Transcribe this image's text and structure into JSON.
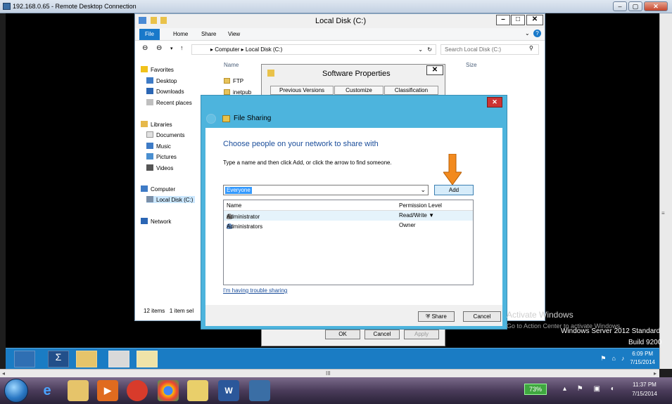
{
  "rdp": {
    "title": "192.168.0.65 - Remote Desktop Connection",
    "min": "–",
    "max": "▢",
    "close": "✕",
    "hscroll_mark": "III"
  },
  "explorer": {
    "title": "Local Disk (C:)",
    "ribbon_tabs": [
      "File",
      "Home",
      "Share",
      "View"
    ],
    "address": [
      "Computer",
      "Local Disk (C:)"
    ],
    "search_placeholder": "Search Local Disk (C:)",
    "nav": [
      {
        "label": "Favorites",
        "icon": "star-icon"
      },
      {
        "label": "Desktop",
        "icon": "desktop-icon"
      },
      {
        "label": "Downloads",
        "icon": "downloads-icon"
      },
      {
        "label": "Recent places",
        "icon": "recent-places-icon"
      },
      {
        "label": "Libraries",
        "icon": "libraries-icon"
      },
      {
        "label": "Documents",
        "icon": "documents-icon"
      },
      {
        "label": "Music",
        "icon": "music-icon"
      },
      {
        "label": "Pictures",
        "icon": "pictures-icon"
      },
      {
        "label": "Videos",
        "icon": "videos-icon"
      },
      {
        "label": "Computer",
        "icon": "computer-icon"
      },
      {
        "label": "Local Disk (C:)",
        "icon": "drive-icon"
      },
      {
        "label": "Network",
        "icon": "network-icon"
      }
    ],
    "columns": {
      "name": "Name",
      "size": "Size"
    },
    "files": [
      "FTP",
      "inetpub"
    ],
    "status_items": "12 items",
    "status_selected": "1 item sel"
  },
  "props": {
    "title": "Software Properties",
    "tabs": [
      "Previous Versions",
      "Customize",
      "Classification"
    ],
    "ok": "OK",
    "cancel": "Cancel",
    "apply": "Apply"
  },
  "file_sharing": {
    "title": "File Sharing",
    "heading": "Choose people on your network to share with",
    "instruction": "Type a name and then click Add, or click the arrow to find someone.",
    "input_value": "Everyone",
    "add_button": "Add",
    "table_headers": {
      "name": "Name",
      "permission": "Permission Level"
    },
    "rows": [
      {
        "name": "Administrator",
        "permission": "Read/Write ▼"
      },
      {
        "name": "Administrators",
        "permission": "Owner"
      }
    ],
    "trouble_link": "I'm having trouble sharing",
    "share_button": "Share",
    "cancel_button": "Cancel"
  },
  "watermark": {
    "line1": "Activate Windows",
    "line2": "Go to Action Center to activate Windows.",
    "os": "Windows Server 2012 Standard",
    "build": "Build 9200"
  },
  "remote_taskbar": {
    "time": "6:09 PM",
    "date": "7/15/2014"
  },
  "host_taskbar": {
    "battery": "73%",
    "time": "11:37 PM",
    "date": "7/15/2014"
  },
  "colors": {
    "remote_taskbar": "#1a7cc4",
    "dialog_frame": "#4db4dd",
    "add_arrow": "#f28a1e"
  }
}
